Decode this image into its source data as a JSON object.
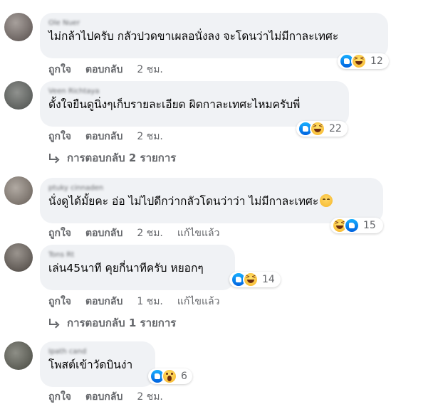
{
  "comments": [
    {
      "author": "Ole Nuer",
      "text": "ไม่กล้าไปครับ กลัวปวดขาเผลอนั่งลง จะโดนว่าไม่มีกาละเทศะ",
      "reactions": [
        "like-icon",
        "haha-icon"
      ],
      "reaction_count": "12",
      "like_label": "ถูกใจ",
      "reply_label": "ตอบกลับ",
      "time": "2 ชม."
    },
    {
      "author": "Veen Richtaya",
      "text": "ตั้งใจยืนดูนิ่งๆเก็บรายละเอียด ผิดกาละเทศะไหมครับพี่",
      "reactions": [
        "like-icon",
        "haha-icon"
      ],
      "reaction_count": "22",
      "like_label": "ถูกใจ",
      "reply_label": "ตอบกลับ",
      "time": "2 ชม.",
      "replies_label": "การตอบกลับ 2 รายการ"
    },
    {
      "author": "ptuky cinnaden",
      "text": "นั่งดูได้มั้ยคะ อ่อ ไม่ไปดีกว่ากลัวโดนว่าว่า ไม่มีกาละเทศะ",
      "reactions": [
        "haha-icon",
        "like-icon"
      ],
      "reaction_count": "15",
      "like_label": "ถูกใจ",
      "reply_label": "ตอบกลับ",
      "time": "2 ชม.",
      "edited": "แก้ไขแล้ว"
    },
    {
      "author": "Tons Rt",
      "text": "เล่น45นาที คุยกี่นาทีครับ หยอกๆ",
      "reactions": [
        "like-icon",
        "haha-icon"
      ],
      "reaction_count": "14",
      "like_label": "ถูกใจ",
      "reply_label": "ตอบกลับ",
      "time": "1 ชม.",
      "edited": "แก้ไขแล้ว",
      "replies_label": "การตอบกลับ 1 รายการ"
    },
    {
      "author": "Ipath cand",
      "text": "โพสต์เข้าวัดบินง่า",
      "reactions": [
        "like-icon",
        "wow-icon"
      ],
      "reaction_count": "6",
      "like_label": "ถูกใจ",
      "reply_label": "ตอบกลับ",
      "time": "2 ชม."
    }
  ]
}
